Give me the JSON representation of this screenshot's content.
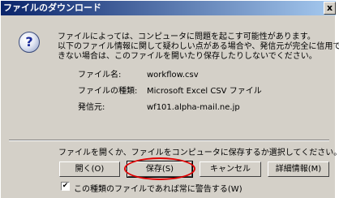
{
  "window": {
    "title": "ファイルのダウンロード",
    "close_label": "x"
  },
  "message": {
    "icon": "question-icon",
    "lines": [
      "ファイルによっては、コンピュータに問題を起こす可能性があります。",
      "以下のファイル情報に関して疑わしい点がある場合や、発信元が完全に信用で",
      "きない場合は、このファイルを開いたり保存したりしないでください。"
    ]
  },
  "file_info": {
    "name_label": "ファイル名:",
    "name_value": "workflow.csv",
    "type_label": "ファイルの種類:",
    "type_value": "Microsoft Excel CSV ファイル",
    "source_label": "発信元:",
    "source_value": "wf101.alpha-mail.ne.jp"
  },
  "prompt": "ファイルを開くか、ファイルをコンピュータに保存するか選択してください。",
  "buttons": {
    "open": "開く(O)",
    "save": "保存(S)",
    "cancel": "キャンセル",
    "details": "詳細情報(M)"
  },
  "checkbox": {
    "label": "この種類のファイルであれば常に警告する(W)",
    "checked": true,
    "check_mark": "✔"
  },
  "annotation": {
    "highlight_color": "#e00000"
  }
}
